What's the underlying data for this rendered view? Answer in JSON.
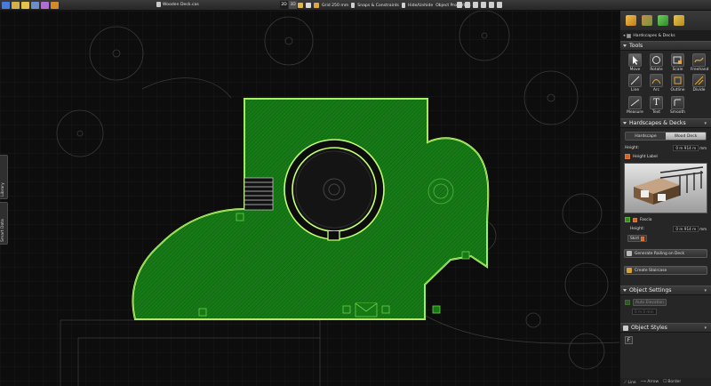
{
  "toolbar": {
    "document_title": "Wooden Deck.cas",
    "view_2d": "2D",
    "view_3d": "3D",
    "grid_label": "Grid 250 mm",
    "snaps_label": "Snaps & Constraints",
    "hide_unhide_label": "Hide/Unhide",
    "object_properties_label": "Object Properties"
  },
  "side_tabs": {
    "library": "Library",
    "smart_data": "Smart Data"
  },
  "panel": {
    "breadcrumb": "Hardscapes & Decks",
    "tools_header": "Tools",
    "tools": [
      {
        "label": "Move",
        "icon": "move-arrow-icon"
      },
      {
        "label": "Rotate",
        "icon": "rotate-icon"
      },
      {
        "label": "Scale",
        "icon": "scale-icon"
      },
      {
        "label": "Freehand",
        "icon": "freehand-icon"
      },
      {
        "label": "Line",
        "icon": "line-icon"
      },
      {
        "label": "Arc",
        "icon": "arc-icon"
      },
      {
        "label": "Outline",
        "icon": "outline-icon"
      },
      {
        "label": "Divide",
        "icon": "divide-icon"
      }
    ],
    "tools_row2": [
      {
        "label": "Measure",
        "icon": "measure-icon"
      },
      {
        "label": "Text",
        "icon": "text-icon"
      },
      {
        "label": "Smooth",
        "icon": "smooth-icon"
      }
    ],
    "hd_header": "Hardscapes & Decks",
    "seg_hardscape": "Hardscape",
    "seg_wood_deck": "Wood Deck",
    "height_label": "Height:",
    "height_value": "0 m  914 m",
    "height_unit": "mm",
    "height_label_check": "Height Label",
    "fascia_label": "Fascia",
    "fascia_height_label": "Height:",
    "fascia_height_value": "0 m  914 m",
    "skirt_label": "Skirt",
    "generate_railing": "Generate Railing on Deck",
    "create_staircase": "Create Staircase",
    "object_settings_header": "Object Settings",
    "auto_elevation": "Auto Elevation",
    "elevation_value": "0 m  0 mm",
    "object_styles_header": "Object Styles",
    "bottom_line": "Line",
    "bottom_arrow": "Arrow",
    "bottom_border": "Border"
  },
  "colors": {
    "deck_fill": "#157a15",
    "deck_outline": "#b8ff6a",
    "grid": "#1f1f1f",
    "panel_bg": "#262626"
  }
}
